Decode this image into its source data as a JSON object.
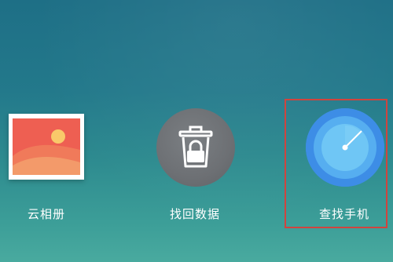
{
  "apps": [
    {
      "id": "album",
      "label": "云相册",
      "icon": "photo-album-icon"
    },
    {
      "id": "recover",
      "label": "找回数据",
      "icon": "trash-lock-icon"
    },
    {
      "id": "find",
      "label": "查找手机",
      "icon": "radar-icon"
    }
  ],
  "colors": {
    "background_top": "#1e6f86",
    "background_bottom": "#49aa9f",
    "highlight": "#d0443e",
    "album_red": "#ee5f52",
    "recover_gray": "#6d7074",
    "find_blue": "#3f8fe8"
  },
  "highlighted_app": "find"
}
